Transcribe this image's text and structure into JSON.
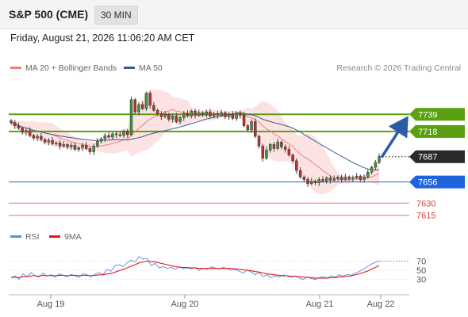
{
  "header": {
    "title": "S&P 500 (CME)",
    "interval": "30 MIN"
  },
  "timestamp": "Friday, August 21, 2026 11:06:20 AM CET",
  "legend": {
    "bb": {
      "label": "MA 20 + Bollinger Bands",
      "color": "#f08080"
    },
    "ma50": {
      "label": "MA 50",
      "color": "#3c5a8c"
    },
    "rsi": {
      "label": "RSI",
      "color": "#5b8fe0"
    },
    "rsi_ma": {
      "label": "9MA",
      "color": "#e01818"
    }
  },
  "credit": "Research © 2026 Trading Central",
  "chart_data": {
    "type": "candlestick",
    "price_axis": {
      "min": 7604,
      "max": 7785
    },
    "x_labels": [
      "Aug 19",
      "Aug 20",
      "Aug 21",
      "Aug 22"
    ],
    "current_price": 7687,
    "levels": [
      {
        "value": 7739,
        "label": "7739",
        "kind": "resistance",
        "color": "#5aa010"
      },
      {
        "value": 7718,
        "label": "7718",
        "kind": "pivot",
        "color": "#5aa010"
      },
      {
        "value": 7687,
        "label": "7687",
        "kind": "last",
        "color": "#2a2a2a"
      },
      {
        "value": 7656,
        "label": "7656",
        "kind": "support",
        "color": "#1e64dc"
      },
      {
        "value": 7630,
        "label": "7630",
        "kind": "support",
        "color": "#e04030"
      },
      {
        "value": 7615,
        "label": "7615",
        "kind": "support",
        "color": "#e04030"
      }
    ],
    "price_path": [
      [
        0,
        7729
      ],
      [
        1,
        7725
      ],
      [
        2,
        7722
      ],
      [
        3,
        7717
      ],
      [
        4,
        7719
      ],
      [
        5,
        7713
      ],
      [
        6,
        7710
      ],
      [
        7,
        7712
      ],
      [
        8,
        7708
      ],
      [
        9,
        7705
      ],
      [
        10,
        7707
      ],
      [
        11,
        7703
      ],
      [
        12,
        7704
      ],
      [
        13,
        7700
      ],
      [
        14,
        7702
      ],
      [
        15,
        7699
      ],
      [
        16,
        7701
      ],
      [
        17,
        7696
      ],
      [
        18,
        7698
      ],
      [
        19,
        7701
      ],
      [
        20,
        7697
      ],
      [
        21,
        7693
      ],
      [
        22,
        7700
      ],
      [
        23,
        7706
      ],
      [
        24,
        7709
      ],
      [
        25,
        7713
      ],
      [
        26,
        7711
      ],
      [
        27,
        7715
      ],
      [
        28,
        7714
      ],
      [
        29,
        7713
      ],
      [
        30,
        7718
      ],
      [
        31,
        7714
      ],
      [
        32,
        7757
      ],
      [
        33,
        7742
      ],
      [
        34,
        7751
      ],
      [
        35,
        7746
      ],
      [
        36,
        7765
      ],
      [
        37,
        7750
      ],
      [
        38,
        7744
      ],
      [
        39,
        7740
      ],
      [
        40,
        7736
      ],
      [
        41,
        7739
      ],
      [
        42,
        7733
      ],
      [
        43,
        7737
      ],
      [
        44,
        7730
      ],
      [
        45,
        7735
      ],
      [
        46,
        7740
      ],
      [
        47,
        7737
      ],
      [
        48,
        7743
      ],
      [
        49,
        7738
      ],
      [
        50,
        7741
      ],
      [
        51,
        7739
      ],
      [
        52,
        7742
      ],
      [
        53,
        7737
      ],
      [
        54,
        7740
      ],
      [
        55,
        7738
      ],
      [
        56,
        7741
      ],
      [
        57,
        7736
      ],
      [
        58,
        7739
      ],
      [
        59,
        7734
      ],
      [
        60,
        7741
      ],
      [
        61,
        7738
      ],
      [
        62,
        7725
      ],
      [
        63,
        7720
      ],
      [
        64,
        7730
      ],
      [
        65,
        7712
      ],
      [
        66,
        7700
      ],
      [
        67,
        7685
      ],
      [
        68,
        7695
      ],
      [
        69,
        7702
      ],
      [
        70,
        7697
      ],
      [
        71,
        7705
      ],
      [
        72,
        7699
      ],
      [
        73,
        7696
      ],
      [
        74,
        7689
      ],
      [
        75,
        7682
      ],
      [
        76,
        7670
      ],
      [
        77,
        7662
      ],
      [
        78,
        7659
      ],
      [
        79,
        7654
      ],
      [
        80,
        7657
      ],
      [
        81,
        7655
      ],
      [
        82,
        7659
      ],
      [
        83,
        7657
      ],
      [
        84,
        7661
      ],
      [
        85,
        7658
      ],
      [
        86,
        7660
      ],
      [
        87,
        7662
      ],
      [
        88,
        7659
      ],
      [
        89,
        7662
      ],
      [
        90,
        7660
      ],
      [
        91,
        7661
      ],
      [
        92,
        7663
      ],
      [
        93,
        7659
      ],
      [
        94,
        7662
      ],
      [
        95,
        7668
      ],
      [
        96,
        7674
      ],
      [
        97,
        7680
      ],
      [
        98,
        7687
      ]
    ],
    "rsi": {
      "range": [
        0,
        100
      ],
      "ticks": [
        70,
        50,
        30
      ],
      "series": [
        {
          "name": "RSI",
          "values": [
            34,
            38,
            30,
            42,
            36,
            45,
            38,
            35,
            44,
            37,
            40,
            35,
            42,
            39,
            36,
            41,
            38,
            35,
            43,
            40,
            36,
            42,
            45,
            41,
            52,
            48,
            60,
            62,
            58,
            66,
            72,
            68,
            80,
            74,
            76,
            60,
            65,
            55,
            58,
            54,
            56,
            52,
            57,
            54,
            55,
            53,
            56,
            50,
            54,
            52,
            57,
            55,
            53,
            56,
            54,
            50,
            52,
            48,
            44,
            50,
            46,
            40,
            45,
            36,
            40,
            34,
            38,
            35,
            40,
            37,
            34,
            38,
            33,
            30,
            35,
            32,
            30,
            34,
            36,
            33,
            38,
            35,
            40,
            37,
            41,
            39,
            44,
            47,
            52,
            58,
            63,
            67,
            70
          ]
        },
        {
          "name": "9MA",
          "values": [
            34,
            35,
            34,
            36,
            36,
            38,
            38,
            37,
            39,
            38,
            39,
            38,
            39,
            39,
            38,
            39,
            39,
            38,
            39,
            39,
            38,
            39,
            40,
            40,
            42,
            43,
            46,
            49,
            52,
            55,
            59,
            62,
            66,
            68,
            70,
            69,
            68,
            66,
            64,
            62,
            60,
            58,
            57,
            56,
            56,
            55,
            55,
            54,
            54,
            54,
            54,
            54,
            54,
            54,
            54,
            54,
            53,
            52,
            51,
            50,
            49,
            47,
            46,
            44,
            42,
            41,
            40,
            39,
            38,
            38,
            37,
            37,
            36,
            35,
            35,
            34,
            33,
            33,
            33,
            33,
            34,
            34,
            35,
            36,
            37,
            38,
            40,
            42,
            45,
            48,
            52,
            56,
            60
          ]
        }
      ]
    }
  }
}
